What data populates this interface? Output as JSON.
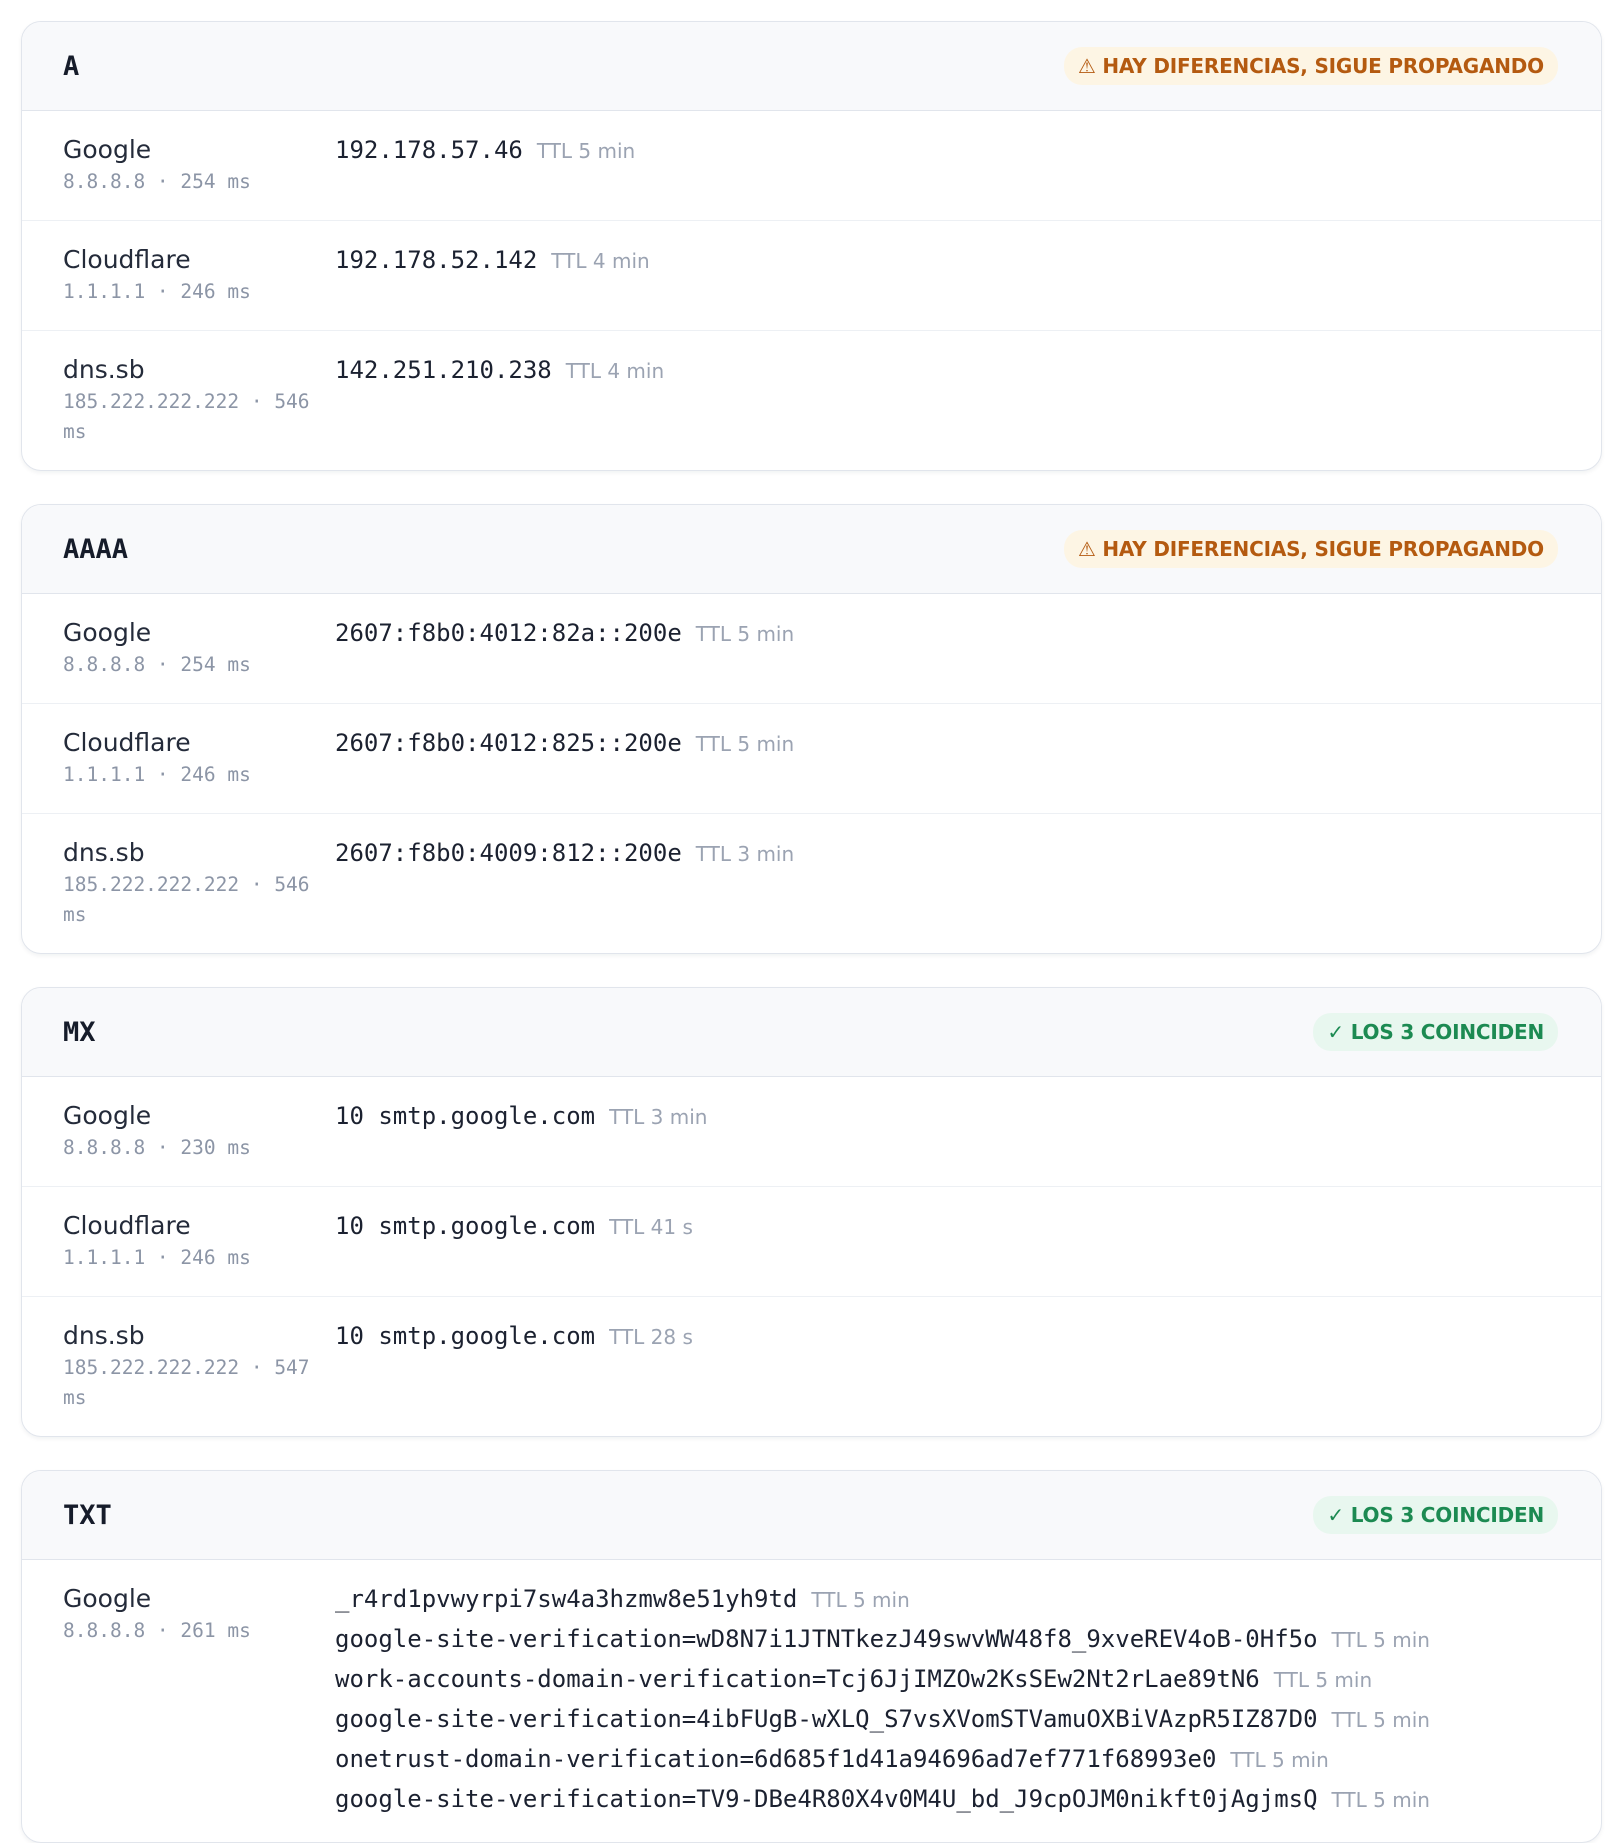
{
  "sections": [
    {
      "type": "A",
      "badge": {
        "text": "⚠ HAY DIFERENCIAS, SIGUE PROPAGANDO",
        "status": "warn"
      },
      "rows": [
        {
          "name": "Google",
          "meta": "8.8.8.8 · 254 ms",
          "values": [
            {
              "value": "192.178.57.46",
              "ttl": "TTL 5 min"
            }
          ]
        },
        {
          "name": "Cloudflare",
          "meta": "1.1.1.1 · 246 ms",
          "values": [
            {
              "value": "192.178.52.142",
              "ttl": "TTL 4 min"
            }
          ]
        },
        {
          "name": "dns.sb",
          "meta": "185.222.222.222 · 546 ms",
          "values": [
            {
              "value": "142.251.210.238",
              "ttl": "TTL 4 min"
            }
          ]
        }
      ]
    },
    {
      "type": "AAAA",
      "badge": {
        "text": "⚠ HAY DIFERENCIAS, SIGUE PROPAGANDO",
        "status": "warn"
      },
      "rows": [
        {
          "name": "Google",
          "meta": "8.8.8.8 · 254 ms",
          "values": [
            {
              "value": "2607:f8b0:4012:82a::200e",
              "ttl": "TTL 5 min"
            }
          ]
        },
        {
          "name": "Cloudflare",
          "meta": "1.1.1.1 · 246 ms",
          "values": [
            {
              "value": "2607:f8b0:4012:825::200e",
              "ttl": "TTL 5 min"
            }
          ]
        },
        {
          "name": "dns.sb",
          "meta": "185.222.222.222 · 546 ms",
          "values": [
            {
              "value": "2607:f8b0:4009:812::200e",
              "ttl": "TTL 3 min"
            }
          ]
        }
      ]
    },
    {
      "type": "MX",
      "badge": {
        "text": "✓ LOS 3 COINCIDEN",
        "status": "ok"
      },
      "rows": [
        {
          "name": "Google",
          "meta": "8.8.8.8 · 230 ms",
          "values": [
            {
              "value": "10 smtp.google.com",
              "ttl": "TTL 3 min"
            }
          ]
        },
        {
          "name": "Cloudflare",
          "meta": "1.1.1.1 · 246 ms",
          "values": [
            {
              "value": "10 smtp.google.com",
              "ttl": "TTL 41 s"
            }
          ]
        },
        {
          "name": "dns.sb",
          "meta": "185.222.222.222 · 547 ms",
          "values": [
            {
              "value": "10 smtp.google.com",
              "ttl": "TTL 28 s"
            }
          ]
        }
      ]
    },
    {
      "type": "TXT",
      "badge": {
        "text": "✓ LOS 3 COINCIDEN",
        "status": "ok"
      },
      "rows": [
        {
          "name": "Google",
          "meta": "8.8.8.8 · 261 ms",
          "values": [
            {
              "value": "_r4rd1pvwyrpi7sw4a3hzmw8e51yh9td",
              "ttl": "TTL 5 min"
            },
            {
              "value": "google-site-verification=wD8N7i1JTNTkezJ49swvWW48f8_9xveREV4oB-0Hf5o",
              "ttl": "TTL 5 min"
            },
            {
              "value": "work-accounts-domain-verification=Tcj6JjIMZOw2KsSEw2Nt2rLae89tN6",
              "ttl": "TTL 5 min"
            },
            {
              "value": "google-site-verification=4ibFUgB-wXLQ_S7vsXVomSTVamuOXBiVAzpR5IZ87D0",
              "ttl": "TTL 5 min"
            },
            {
              "value": "onetrust-domain-verification=6d685f1d41a94696ad7ef771f68993e0",
              "ttl": "TTL 5 min"
            },
            {
              "value": "google-site-verification=TV9-DBe4R80X4v0M4U_bd_J9cpOJM0nikft0jAgjmsQ",
              "ttl": "TTL 5 min"
            }
          ]
        }
      ]
    }
  ]
}
